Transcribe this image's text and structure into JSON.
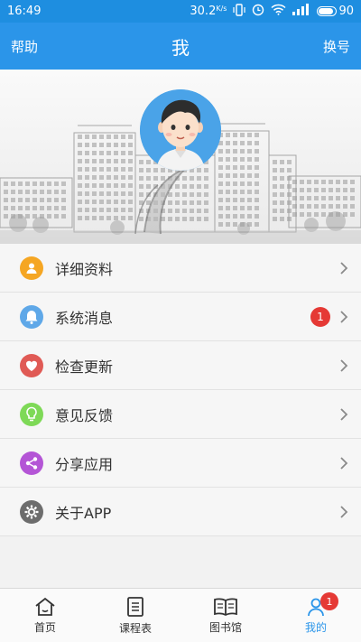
{
  "status_bar": {
    "time": "16:49",
    "speed": "30.2",
    "speed_unit": "K/s",
    "battery": "90"
  },
  "app_bar": {
    "left_label": "帮助",
    "title": "我",
    "right_label": "换号"
  },
  "menu": {
    "items": [
      {
        "label": "详细资料",
        "icon": "profile-icon",
        "color": "#f5a623"
      },
      {
        "label": "系统消息",
        "icon": "bell-icon",
        "color": "#5fa8e8",
        "badge": "1"
      },
      {
        "label": "检查更新",
        "icon": "heart-icon",
        "color": "#e05a55"
      },
      {
        "label": "意见反馈",
        "icon": "bulb-icon",
        "color": "#7ed957"
      },
      {
        "label": "分享应用",
        "icon": "share-icon",
        "color": "#b455d6"
      },
      {
        "label": "关于APP",
        "icon": "gear-icon",
        "color": "#6d6d6d"
      }
    ]
  },
  "tab_bar": {
    "tabs": [
      {
        "label": "首页",
        "icon": "home-icon"
      },
      {
        "label": "课程表",
        "icon": "schedule-icon"
      },
      {
        "label": "图书馆",
        "icon": "book-icon"
      },
      {
        "label": "我的",
        "icon": "user-icon",
        "badge": "1",
        "active": true
      }
    ]
  }
}
